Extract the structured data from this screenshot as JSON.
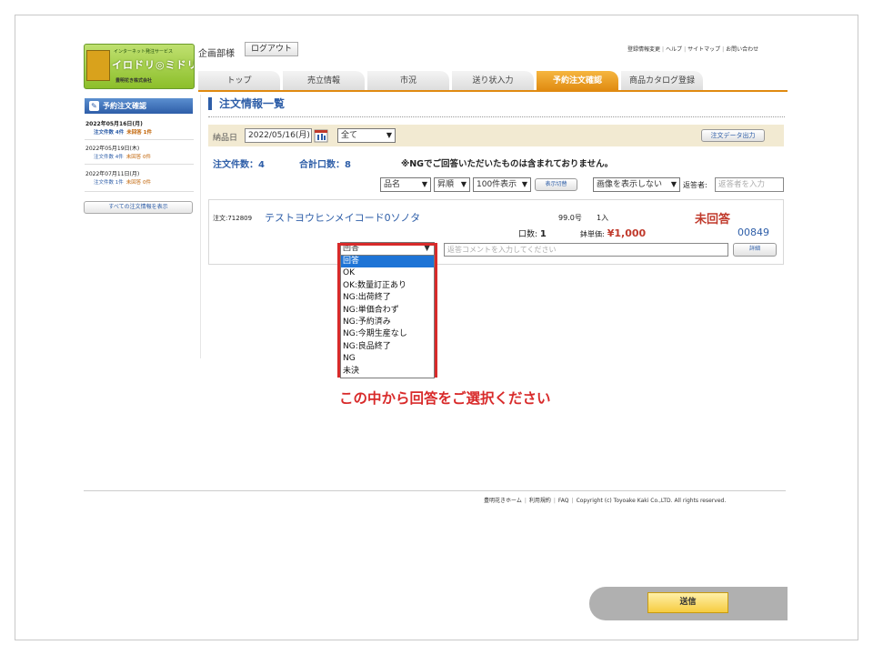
{
  "logo": {
    "tagline": "インターネット発注サービス",
    "brand": "イロドリ◎ミドリ",
    "company": "豊明花き株式会社"
  },
  "header": {
    "user": "企画部様",
    "logout": "ログアウト",
    "links": [
      "登録情報変更",
      "ヘルプ",
      "サイトマップ",
      "お問い合わせ"
    ]
  },
  "tabs": [
    {
      "label": "トップ",
      "active": false
    },
    {
      "label": "売立情報",
      "active": false
    },
    {
      "label": "市況",
      "active": false
    },
    {
      "label": "送り状入力",
      "active": false
    },
    {
      "label": "予約注文確認",
      "active": true
    },
    {
      "label": "商品カタログ登録",
      "active": false
    }
  ],
  "sidebar": {
    "title": "予約注文確認",
    "entries": [
      {
        "date": "2022年05月16日(月)",
        "count_label": "注文件数 4件",
        "unanswered": "未回答 1件",
        "current": true
      },
      {
        "date": "2022年05月19日(木)",
        "count_label": "注文件数 4件",
        "unanswered": "未回答 0件",
        "current": false
      },
      {
        "date": "2022年07月11日(月)",
        "count_label": "注文件数 1件",
        "unanswered": "未回答 0件",
        "current": false
      }
    ],
    "show_all": "すべての注文情報を表示"
  },
  "main": {
    "title": "注文情報一覧",
    "filter": {
      "delivery_label": "納品日",
      "delivery_date": "2022/05/16(月)",
      "scope": "全て",
      "export": "注文データ出力"
    },
    "summary": {
      "order_count": "注文件数：4",
      "total_lots": "合計口数：8",
      "ng_note": "※NGでご回答いただいたものは含まれておりません。"
    },
    "controls": {
      "sort_field": "品名",
      "sort_order": "昇順",
      "page_size": "100件表示",
      "toggle_view": "表示切替",
      "image_mode": "画像を表示しない",
      "replier_label": "返答者:",
      "replier_placeholder": "返答者を入力"
    },
    "order": {
      "order_no": "注文:712809",
      "name": "テストヨウヒンメイコード0ソノタ",
      "size": "99.0号",
      "qty_unit": "1入",
      "status": "未回答",
      "lots_label": "口数:",
      "lots_value": "1",
      "price_label": "鉢単価:",
      "price_value": "¥1,000",
      "code": "00849",
      "answer_selected": "回答",
      "comment_placeholder": "返答コメントを入力してください",
      "detail": "詳細"
    },
    "dropdown_options": [
      "回答",
      "OK",
      "OK:数量訂正あり",
      "NG:出荷終了",
      "NG:単価合わず",
      "NG:予約済み",
      "NG:今期生産なし",
      "NG:良品終了",
      "NG",
      "未決"
    ],
    "callout": "この中から回答をご選択ください"
  },
  "footer": {
    "links": [
      "豊明花きホーム",
      "利用規約",
      "FAQ"
    ],
    "copyright": "Copyright (c) Toyoake Kaki Co.,LTD. All rights reserved."
  },
  "submit": "送信",
  "colors": {
    "accent_blue": "#2e5ea8",
    "tab_orange": "#e08a10",
    "alert_red": "#d82a2a"
  }
}
